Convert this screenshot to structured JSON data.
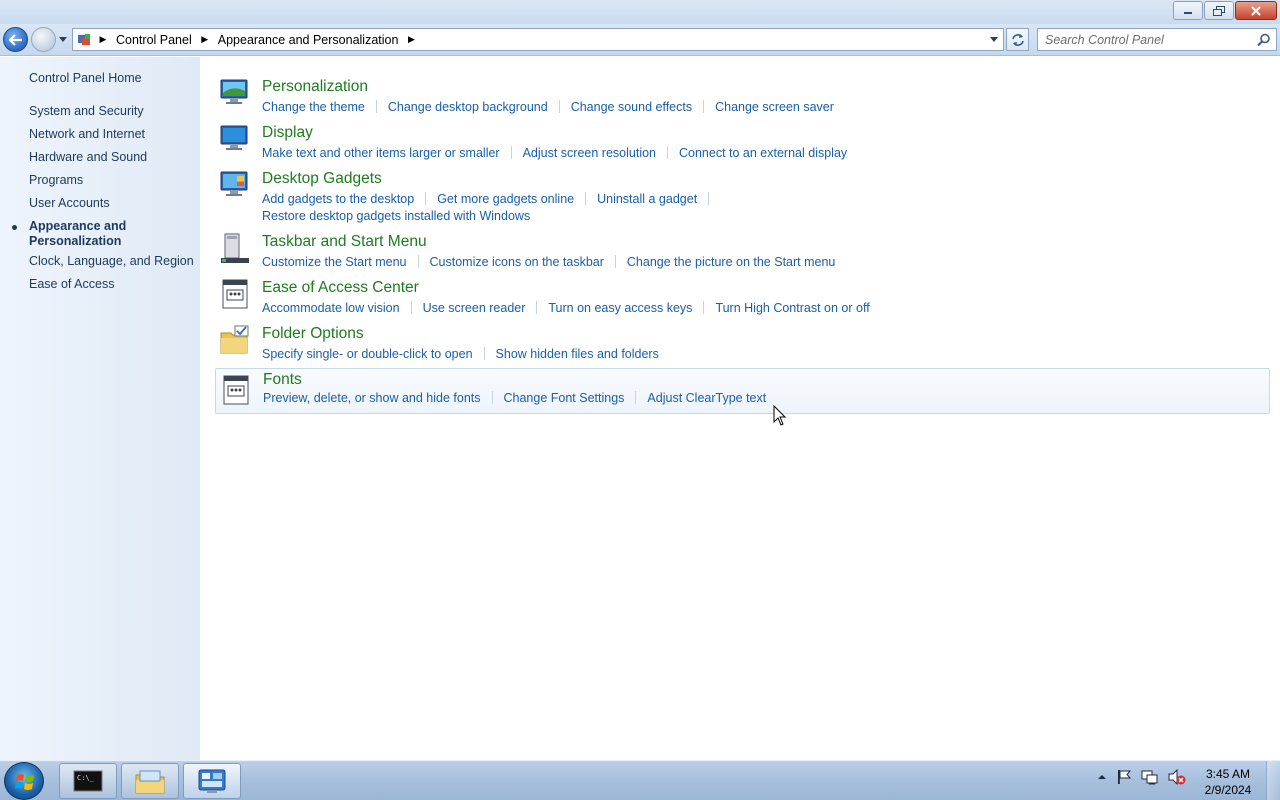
{
  "window": {
    "controls": [
      "minimize",
      "maximize",
      "close"
    ]
  },
  "address_bar": {
    "breadcrumbs": [
      "Control Panel",
      "Appearance and Personalization"
    ],
    "search_placeholder": "Search Control Panel"
  },
  "left_nav": {
    "home": "Control Panel Home",
    "items": [
      {
        "label": "System and Security"
      },
      {
        "label": "Network and Internet"
      },
      {
        "label": "Hardware and Sound"
      },
      {
        "label": "Programs"
      },
      {
        "label": "User Accounts"
      },
      {
        "label": "Appearance and Personalization",
        "current": true
      },
      {
        "label": "Clock, Language, and Region"
      },
      {
        "label": "Ease of Access"
      }
    ]
  },
  "categories": [
    {
      "title": "Personalization",
      "icon": "personalization-icon",
      "links": [
        [
          "Change the theme",
          "Change desktop background",
          "Change sound effects",
          "Change screen saver"
        ]
      ]
    },
    {
      "title": "Display",
      "icon": "display-icon",
      "links": [
        [
          "Make text and other items larger or smaller",
          "Adjust screen resolution",
          "Connect to an external display"
        ]
      ]
    },
    {
      "title": "Desktop Gadgets",
      "icon": "desktop-gadgets-icon",
      "links": [
        [
          "Add gadgets to the desktop",
          "Get more gadgets online",
          "Uninstall a gadget"
        ],
        [
          "Restore desktop gadgets installed with Windows"
        ]
      ]
    },
    {
      "title": "Taskbar and Start Menu",
      "icon": "taskbar-icon",
      "links": [
        [
          "Customize the Start menu",
          "Customize icons on the taskbar",
          "Change the picture on the Start menu"
        ]
      ]
    },
    {
      "title": "Ease of Access Center",
      "icon": "ease-of-access-icon",
      "links": [
        [
          "Accommodate low vision",
          "Use screen reader",
          "Turn on easy access keys",
          "Turn High Contrast on or off"
        ]
      ]
    },
    {
      "title": "Folder Options",
      "icon": "folder-options-icon",
      "links": [
        [
          "Specify single- or double-click to open",
          "Show hidden files and folders"
        ]
      ]
    },
    {
      "title": "Fonts",
      "icon": "fonts-icon",
      "hovered": true,
      "links": [
        [
          "Preview, delete, or show and hide fonts",
          "Change Font Settings",
          "Adjust ClearType text"
        ]
      ]
    }
  ],
  "taskbar": {
    "pinned": [
      "command-prompt-icon",
      "windows-explorer-icon",
      "control-panel-icon"
    ],
    "tray_icons": [
      "show-hidden-icons-chevron",
      "action-center-flag-icon",
      "network-icon",
      "volume-muted-icon"
    ],
    "clock_time": "3:45 AM",
    "clock_date": "2/9/2024"
  },
  "colors": {
    "category_title": "#1e7c1e",
    "link": "#1a5ea8",
    "nav_text": "#1e395b",
    "left_pane_bg": "#e6eff9"
  }
}
